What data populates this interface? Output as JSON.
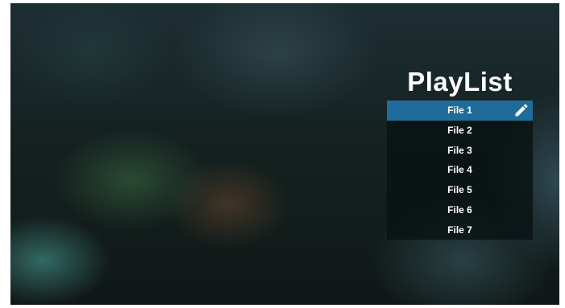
{
  "playlist": {
    "title": "PlayList",
    "selected_index": 0,
    "files": [
      {
        "label": "File 1"
      },
      {
        "label": "File 2"
      },
      {
        "label": "File 3"
      },
      {
        "label": "File 4"
      },
      {
        "label": "File 5"
      },
      {
        "label": "File 6"
      },
      {
        "label": "File 7"
      }
    ],
    "edit_icon": "pencil-icon",
    "colors": {
      "selected_row": "#1f6c9a",
      "text": "#ffffff"
    }
  }
}
